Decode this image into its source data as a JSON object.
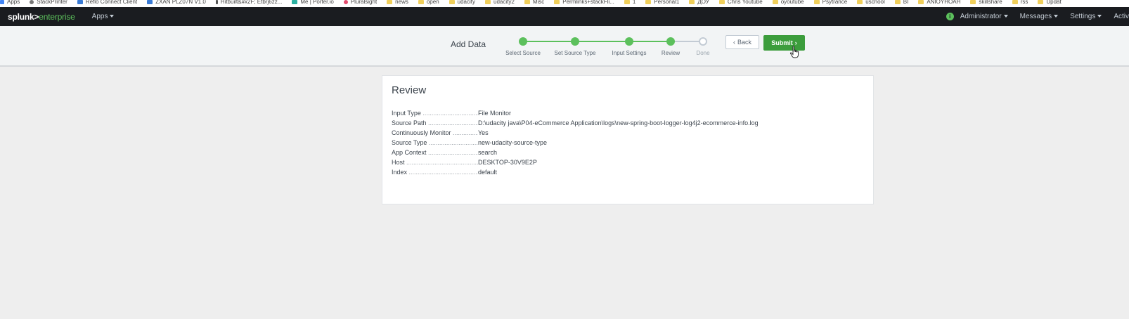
{
  "bookmarks": [
    {
      "label": "Apps",
      "icon": "apps-grid-icon",
      "kind": "grid"
    },
    {
      "label": "StackPrinter",
      "icon": "gear-icon",
      "kind": "gear"
    },
    {
      "label": "Reflo Connect Client",
      "icon": "page-icon",
      "kind": "blue"
    },
    {
      "label": "ZXAN PLZ07N V1.0",
      "icon": "site-icon",
      "kind": "blue"
    },
    {
      "label": "Hitbuilt&#x2F; Etbrj6zz...",
      "icon": "bookmark-icon",
      "kind": "dark"
    },
    {
      "label": "Me | Porter.io",
      "icon": "page-icon",
      "kind": "teal"
    },
    {
      "label": "Pluralsight",
      "icon": "pluralsight-icon",
      "kind": "round"
    },
    {
      "label": "news",
      "icon": "folder-icon",
      "kind": "folder"
    },
    {
      "label": "open",
      "icon": "folder-icon",
      "kind": "folder"
    },
    {
      "label": "udacity",
      "icon": "folder-icon",
      "kind": "folder"
    },
    {
      "label": "udacity2",
      "icon": "folder-icon",
      "kind": "folder"
    },
    {
      "label": "Misc",
      "icon": "folder-icon",
      "kind": "folder"
    },
    {
      "label": "Permlinks+stackFli...",
      "icon": "folder-icon",
      "kind": "folder"
    },
    {
      "label": "1",
      "icon": "folder-icon",
      "kind": "folder"
    },
    {
      "label": "Personal1",
      "icon": "folder-icon",
      "kind": "folder"
    },
    {
      "label": "ДОУ",
      "icon": "folder-icon",
      "kind": "folder"
    },
    {
      "label": "Chris Youtube",
      "icon": "folder-icon",
      "kind": "folder"
    },
    {
      "label": "oyoutube",
      "icon": "folder-icon",
      "kind": "folder"
    },
    {
      "label": "Psytrance",
      "icon": "folder-icon",
      "kind": "folder"
    },
    {
      "label": "uschool",
      "icon": "folder-icon",
      "kind": "folder"
    },
    {
      "label": "BI",
      "icon": "folder-icon",
      "kind": "folder"
    },
    {
      "label": "ANIOYHOAH",
      "icon": "folder-icon",
      "kind": "folder"
    },
    {
      "label": "skillshare",
      "icon": "folder-icon",
      "kind": "folder"
    },
    {
      "label": "rss",
      "icon": "folder-icon",
      "kind": "folder"
    },
    {
      "label": "Updat",
      "icon": "folder-icon",
      "kind": "folder"
    }
  ],
  "topbar": {
    "logo_main": "splunk>",
    "logo_sub": "enterprise",
    "apps_label": "Apps",
    "info_glyph": "i",
    "admin_label": "Administrator",
    "messages_label": "Messages",
    "settings_label": "Settings",
    "activity_label": "Activ"
  },
  "wizard": {
    "title": "Add Data",
    "steps": [
      {
        "label": "Select Source",
        "state": "done"
      },
      {
        "label": "Set Source Type",
        "state": "done"
      },
      {
        "label": "Input Settings",
        "state": "done"
      },
      {
        "label": "Review",
        "state": "current"
      },
      {
        "label": "Done",
        "state": "pending"
      }
    ],
    "back_label": "Back",
    "submit_label": "Submit"
  },
  "review": {
    "title": "Review",
    "rows": [
      {
        "label": "Input Type",
        "value": "File Monitor"
      },
      {
        "label": "Source Path",
        "value": "D:\\udacity java\\P04-eCommerce Application\\logs\\new-spring-boot-logger-log4j2-ecommerce-info.log"
      },
      {
        "label": "Continuously Monitor",
        "value": "Yes"
      },
      {
        "label": "Source Type",
        "value": "new-udacity-source-type"
      },
      {
        "label": "App Context",
        "value": "search"
      },
      {
        "label": "Host",
        "value": "DESKTOP-30V9E2P"
      },
      {
        "label": "Index",
        "value": "default"
      }
    ]
  },
  "colors": {
    "accent_green": "#5cc05c",
    "submit_green": "#3c9d3c",
    "topbar_bg": "#1a1c20",
    "page_bg": "#eeeeee"
  }
}
